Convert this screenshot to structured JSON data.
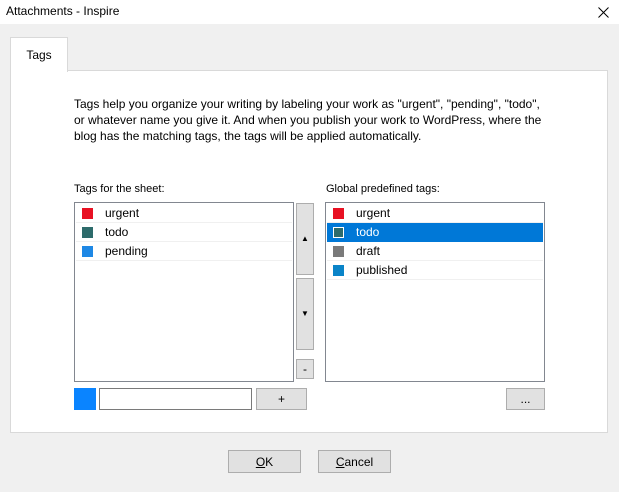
{
  "window": {
    "title": "Attachments - Inspire"
  },
  "tabs": [
    {
      "label": "Tags",
      "active": true
    }
  ],
  "description": "Tags help you organize your writing by labeling your work as \"urgent\", \"pending\", \"todo\", or whatever name you give it. And when you publish your work to WordPress, where the blog has the matching tags, the tags will be applied automatically.",
  "sheet_tags": {
    "label": "Tags for the sheet:",
    "items": [
      {
        "label": "urgent",
        "color": "#e81123"
      },
      {
        "label": "todo",
        "color": "#2d6b6b"
      },
      {
        "label": "pending",
        "color": "#1e88e5"
      }
    ]
  },
  "global_tags": {
    "label": "Global predefined tags:",
    "items": [
      {
        "label": "urgent",
        "color": "#e81123",
        "selected": false
      },
      {
        "label": "todo",
        "color": "#2d6b6b",
        "selected": true
      },
      {
        "label": "draft",
        "color": "#7a7a7a",
        "selected": false
      },
      {
        "label": "published",
        "color": "#0a84c8",
        "selected": false
      }
    ]
  },
  "order_buttons": {
    "up": "▲",
    "down": "▼",
    "remove": "-"
  },
  "new_tag": {
    "color": "#0a84ff",
    "value": "",
    "add_label": "+"
  },
  "more_button": "...",
  "footer": {
    "ok": {
      "accel": "O",
      "rest": "K"
    },
    "cancel": {
      "accel": "C",
      "rest": "ancel"
    }
  },
  "icons": {
    "close": "close-icon",
    "up": "triangle-up-icon",
    "down": "triangle-down-icon"
  }
}
